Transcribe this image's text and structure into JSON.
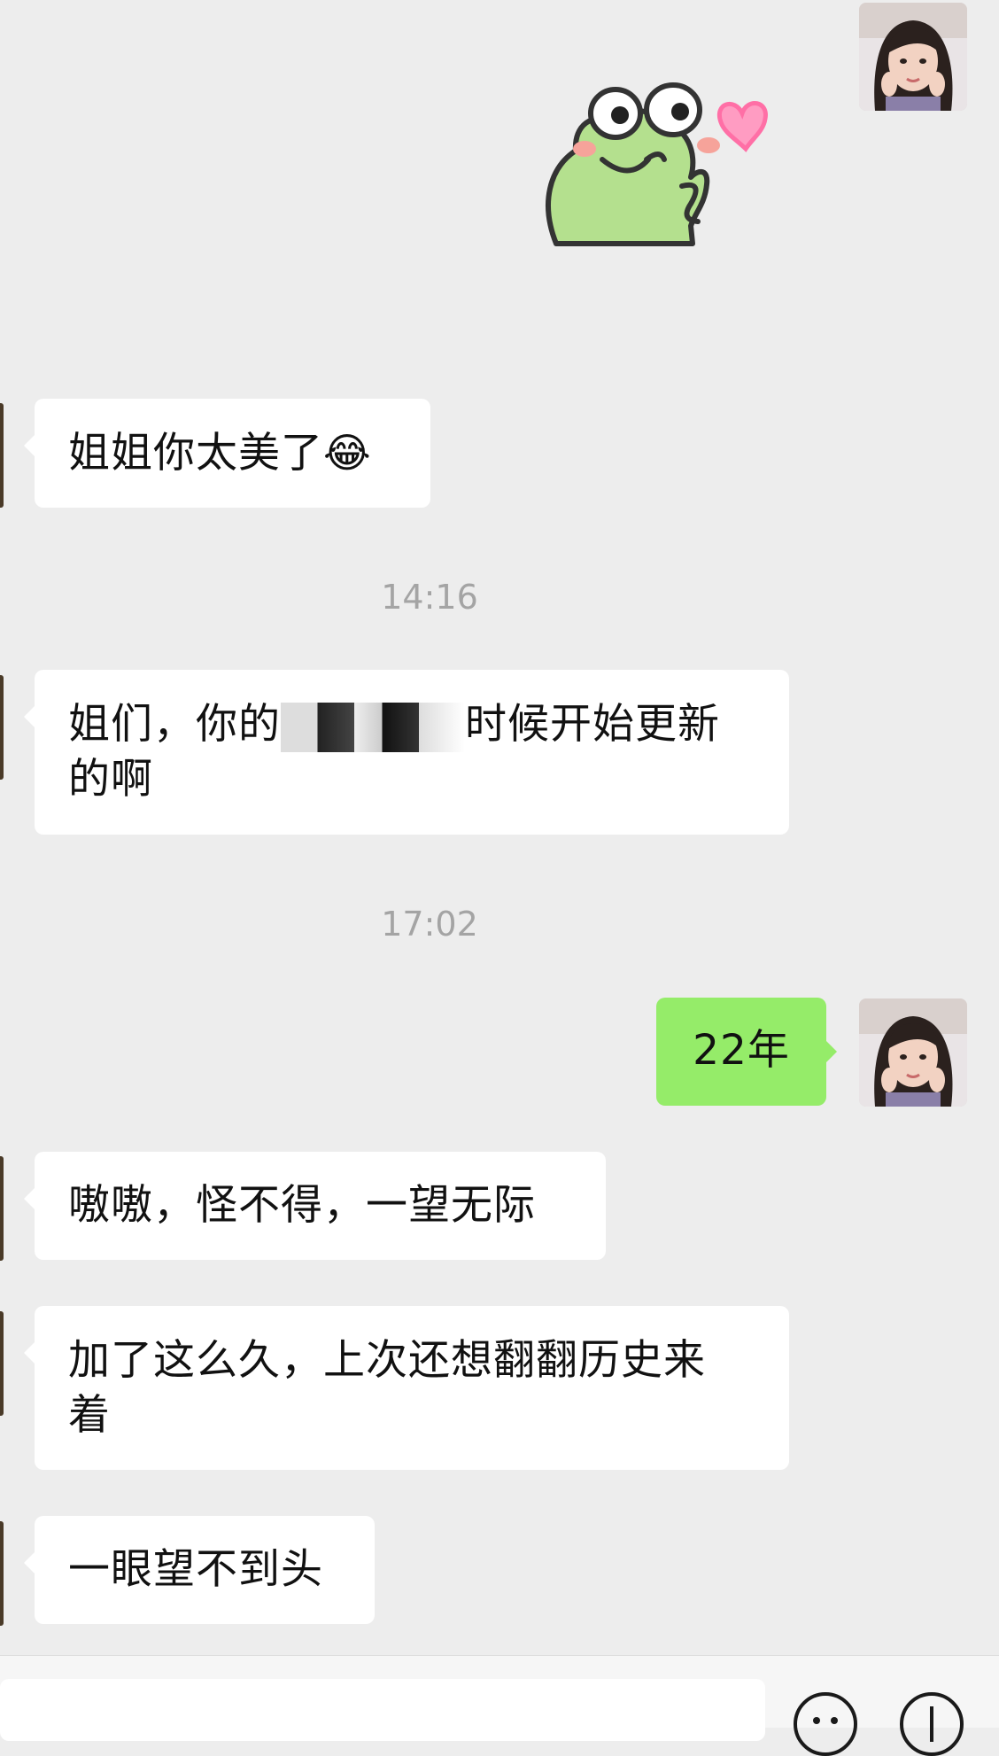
{
  "chat": {
    "messages": [
      {
        "side": "right",
        "kind": "sticker",
        "sticker_icon": "frog-heart-sticker-icon"
      },
      {
        "side": "left",
        "kind": "text",
        "text": "姐姐你太美了",
        "emoji": "😂"
      },
      {
        "kind": "timestamp",
        "text": "14:16"
      },
      {
        "side": "left",
        "kind": "text",
        "text_before": "姐们，你的",
        "text_after": "时候开始更新",
        "text_line2": "的啊"
      },
      {
        "kind": "timestamp",
        "text": "17:02"
      },
      {
        "side": "right",
        "kind": "text",
        "text": "22年"
      },
      {
        "side": "left",
        "kind": "text",
        "text": "嗷嗷，怪不得，一望无际"
      },
      {
        "side": "left",
        "kind": "text",
        "text_line1": "加了这么久，上次还想翻翻历史来",
        "text_line2": "着"
      },
      {
        "side": "left",
        "kind": "text",
        "text": "一眼望不到头"
      }
    ]
  },
  "input_bar": {
    "emoji_button_icon": "smiley-face-icon",
    "more_button_icon": "plus-icon"
  },
  "colors": {
    "background": "#ededed",
    "incoming_bubble": "#ffffff",
    "outgoing_bubble": "#95ec69",
    "timestamp_text": "#a4a4a4"
  }
}
